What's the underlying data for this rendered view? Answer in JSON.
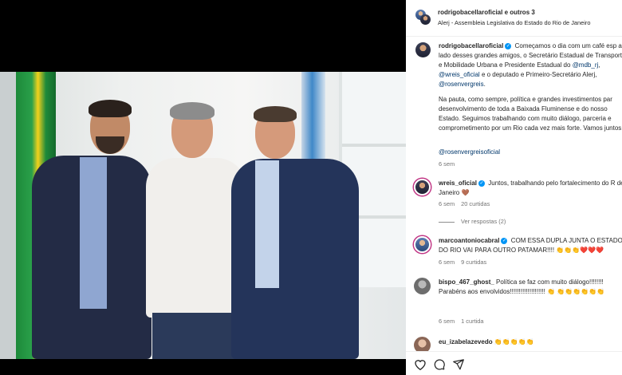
{
  "header": {
    "title": "rodrigobacellaroficial e outros 3",
    "location": "Alerj - Assembleia Legislativa do Estado do Rio de Janeiro"
  },
  "caption": {
    "username": "rodrigobacellaroficial",
    "text_1": "Começamos o dia com um café esp ao lado desses grandes amigos, o Secretário Estadual de Transporte e Mobilidade Urbana e Presidente Estadual do",
    "mention_1": "@mdb_rj",
    "mention_2": "@wreis_oficial",
    "text_2": "e o deputado e Primeiro-Secretário Alerj,",
    "mention_3": "@rosenvergreis",
    "paragraph_2": "Na pauta, como sempre, política e grandes investimentos par desenvolvimento de toda a Baixada Fluminense e do nosso Estado. Seguimos trabalhando com muito diálogo, parceria e comprometimento por um Rio cada vez mais forte. Vamos juntos!",
    "tag": "@rosenvergreisoficial",
    "time": "6 sem"
  },
  "comments": [
    {
      "username": "wreis_oficial",
      "text": "Juntos, trabalhando pelo fortalecimento do R de Janeiro 🤎",
      "time": "6 sem",
      "likes": "20 curtidas",
      "replies": "Ver respostas (2)"
    },
    {
      "username": "marcoantoniocabral",
      "text": "COM ESSA DUPLA JUNTA O ESTADO DO RIO VAI PARA OUTRO PATAMAR!!!! 👏👏👏❤️❤️❤️",
      "time": "6 sem",
      "likes": "9 curtidas"
    },
    {
      "username": "bispo_467_ghost_",
      "text": "Política se faz com muito diálogo!!!!!!!! Parabéns aos envolvidos!!!!!!!!!!!!!!!!!!!! 👏 👏👏👏👏👏👏",
      "time": "6 sem",
      "likes": "1 curtida"
    },
    {
      "username": "eu_izabelazevedo",
      "text": "👏👏👏👏👏"
    }
  ],
  "icons": {
    "like": "heart-icon",
    "comment": "comment-icon",
    "share": "share-icon",
    "verified": "verified-badge-icon"
  },
  "colors": {
    "link": "#00376b",
    "verified": "#0095f6",
    "meta": "#737373"
  }
}
